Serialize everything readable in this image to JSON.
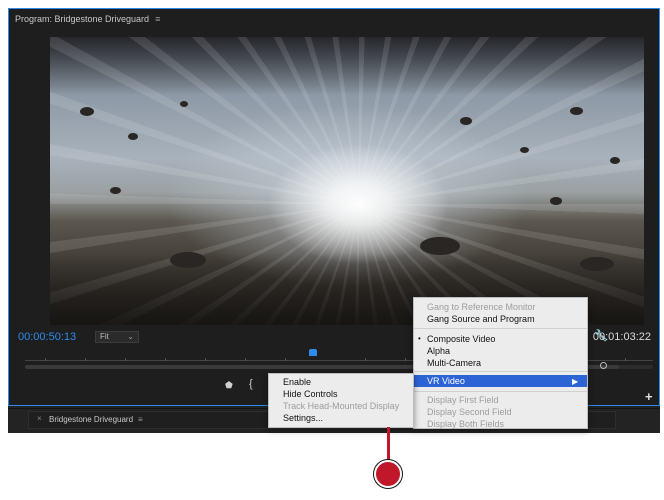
{
  "panel": {
    "title": "Program: Bridgestone Driveguard",
    "menu_glyph": "≡",
    "accent": "#2d8ceb"
  },
  "controls": {
    "timecode_current": "00:00:50:13",
    "zoom_value": "Fit",
    "zoom_chevron_glyph": "⌄",
    "timecode_duration": "00:01:03:22",
    "wrench_icon": "wrench-icon",
    "wrench_glyph": "🔧",
    "marker_glyph": "⬟",
    "inpoint_glyph": "{",
    "add_glyph": "+"
  },
  "bottom_tab": {
    "close_glyph": "×",
    "label": "Bridgestone Driveguard",
    "menu_glyph": "≡"
  },
  "context_menu": {
    "items": [
      {
        "label": "Gang to Reference Monitor",
        "enabled": false
      },
      {
        "label": "Gang Source and Program",
        "enabled": true
      },
      {
        "label": "Composite Video",
        "enabled": true,
        "checked": true
      },
      {
        "label": "Alpha",
        "enabled": true
      },
      {
        "label": "Multi-Camera",
        "enabled": true
      },
      {
        "label": "VR Video",
        "enabled": true,
        "highlighted": true,
        "submenu": true
      },
      {
        "label": "Display First Field",
        "enabled": false
      },
      {
        "label": "Display Second Field",
        "enabled": false
      },
      {
        "label": "Display Both Fields",
        "enabled": false
      }
    ],
    "bullet_glyph": "•",
    "submenu_arrow_glyph": "▶",
    "highlight_color": "#2c64d6"
  },
  "vr_submenu": {
    "items": [
      {
        "label": "Enable",
        "enabled": true
      },
      {
        "label": "Hide Controls",
        "enabled": true
      },
      {
        "label": "Track Head-Mounted Display",
        "enabled": false
      },
      {
        "label": "Settings...",
        "enabled": true
      }
    ]
  },
  "callout": {
    "color": "#c0182a"
  }
}
